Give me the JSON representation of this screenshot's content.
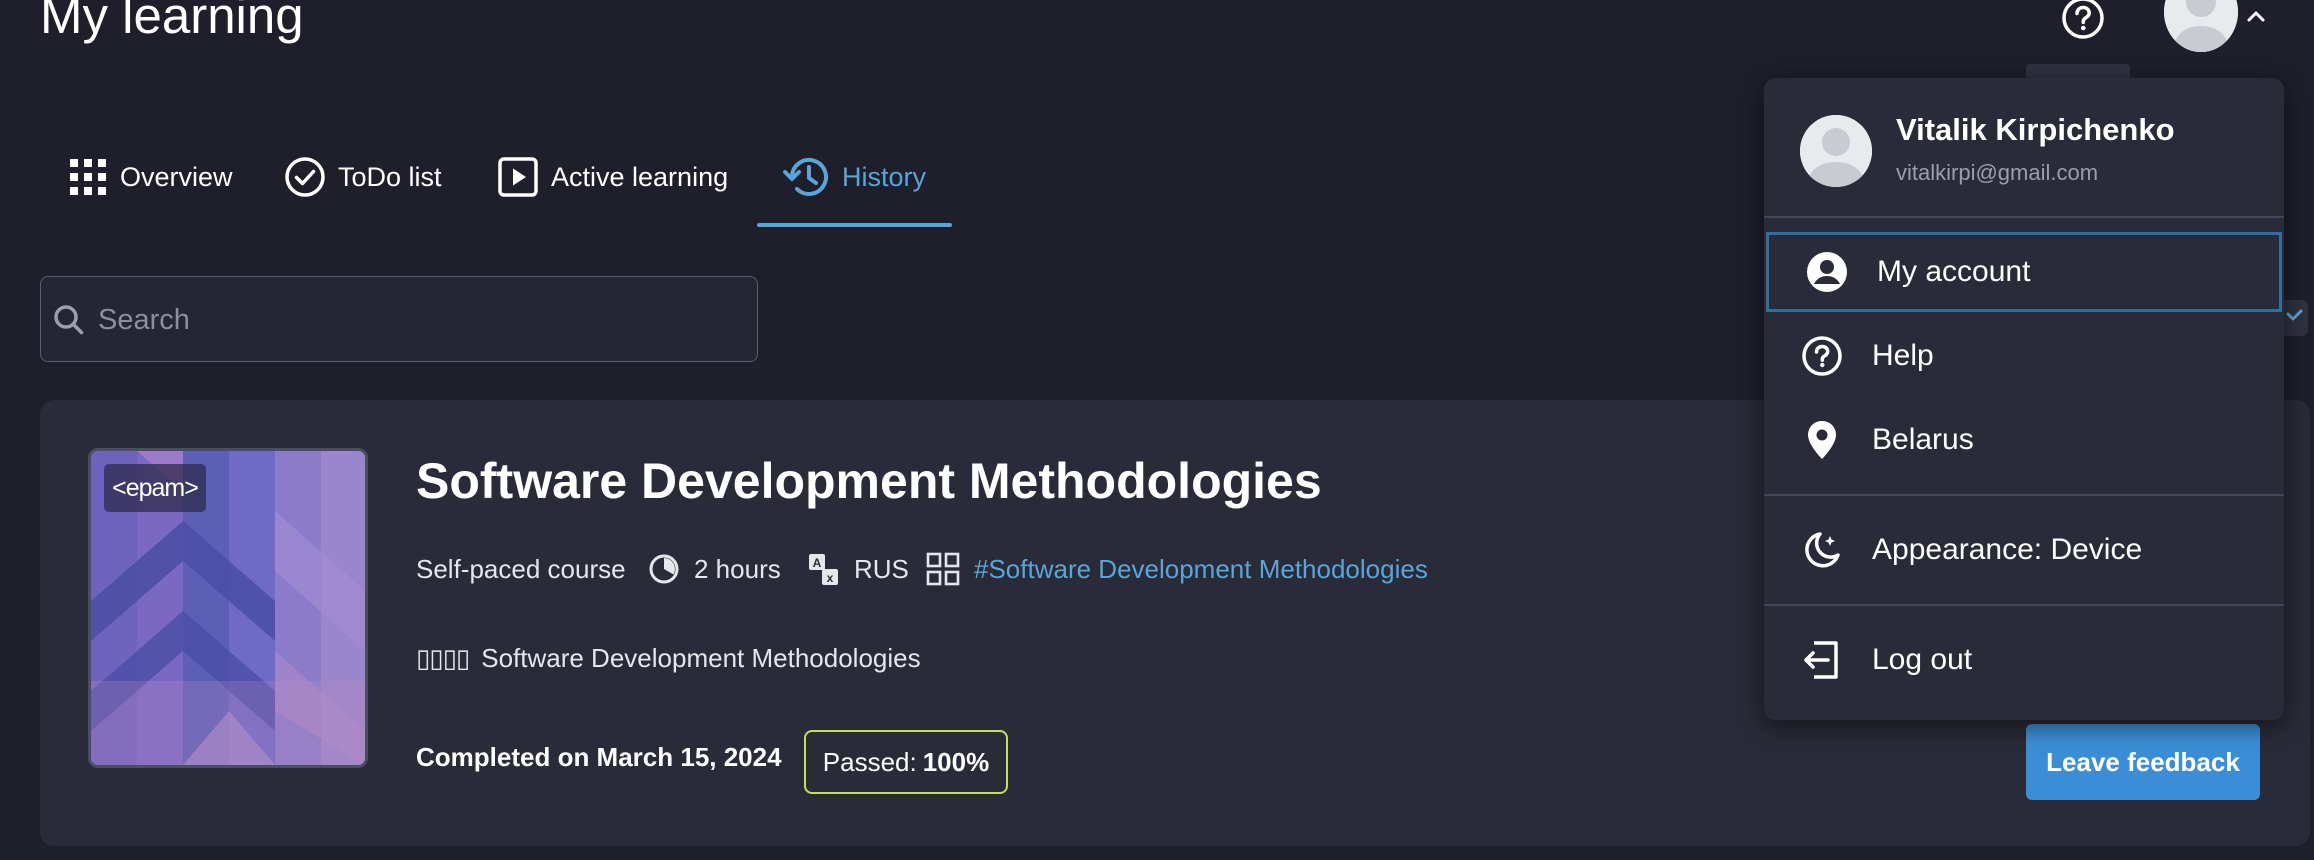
{
  "header": {
    "title": "My learning",
    "help_icon": "question-circle-icon",
    "avatar_icon": "user-avatar",
    "menu_toggle_icon": "chevron-up-icon"
  },
  "tabs": [
    {
      "label": "Overview",
      "icon": "grid-icon",
      "active": false
    },
    {
      "label": "ToDo list",
      "icon": "check-circle-icon",
      "active": false
    },
    {
      "label": "Active learning",
      "icon": "play-square-icon",
      "active": false
    },
    {
      "label": "History",
      "icon": "history-icon",
      "active": true
    }
  ],
  "search": {
    "placeholder": "Search",
    "value": ""
  },
  "course": {
    "logo_text": "<epam>",
    "title": "Software Development Methodologies",
    "type": "Self-paced course",
    "duration": "2 hours",
    "language": "RUS",
    "tag": "#Software Development Methodologies",
    "subtitle_glyphs": "▯▯▯▯",
    "subtitle": "Software Development Methodologies",
    "completed": "Completed on March 15, 2024",
    "passed_label": "Passed:",
    "passed_value": "100%",
    "feedback_label": "Leave feedback"
  },
  "user_menu": {
    "name": "Vitalik Kirpichenko",
    "email": "vitalkirpi@gmail.com",
    "items": [
      {
        "label": "My account",
        "icon": "account-circle-icon"
      },
      {
        "label": "Help",
        "icon": "question-circle-icon"
      },
      {
        "label": "Belarus",
        "icon": "location-pin-icon"
      },
      {
        "label": "Appearance: Device",
        "icon": "moon-icon"
      },
      {
        "label": "Log out",
        "icon": "logout-icon"
      }
    ]
  },
  "colors": {
    "background": "#1e1f2b",
    "card": "#2a2b38",
    "accent": "#5aa5d8",
    "button": "#3b8ed6",
    "passed_border": "#c4df5c"
  }
}
